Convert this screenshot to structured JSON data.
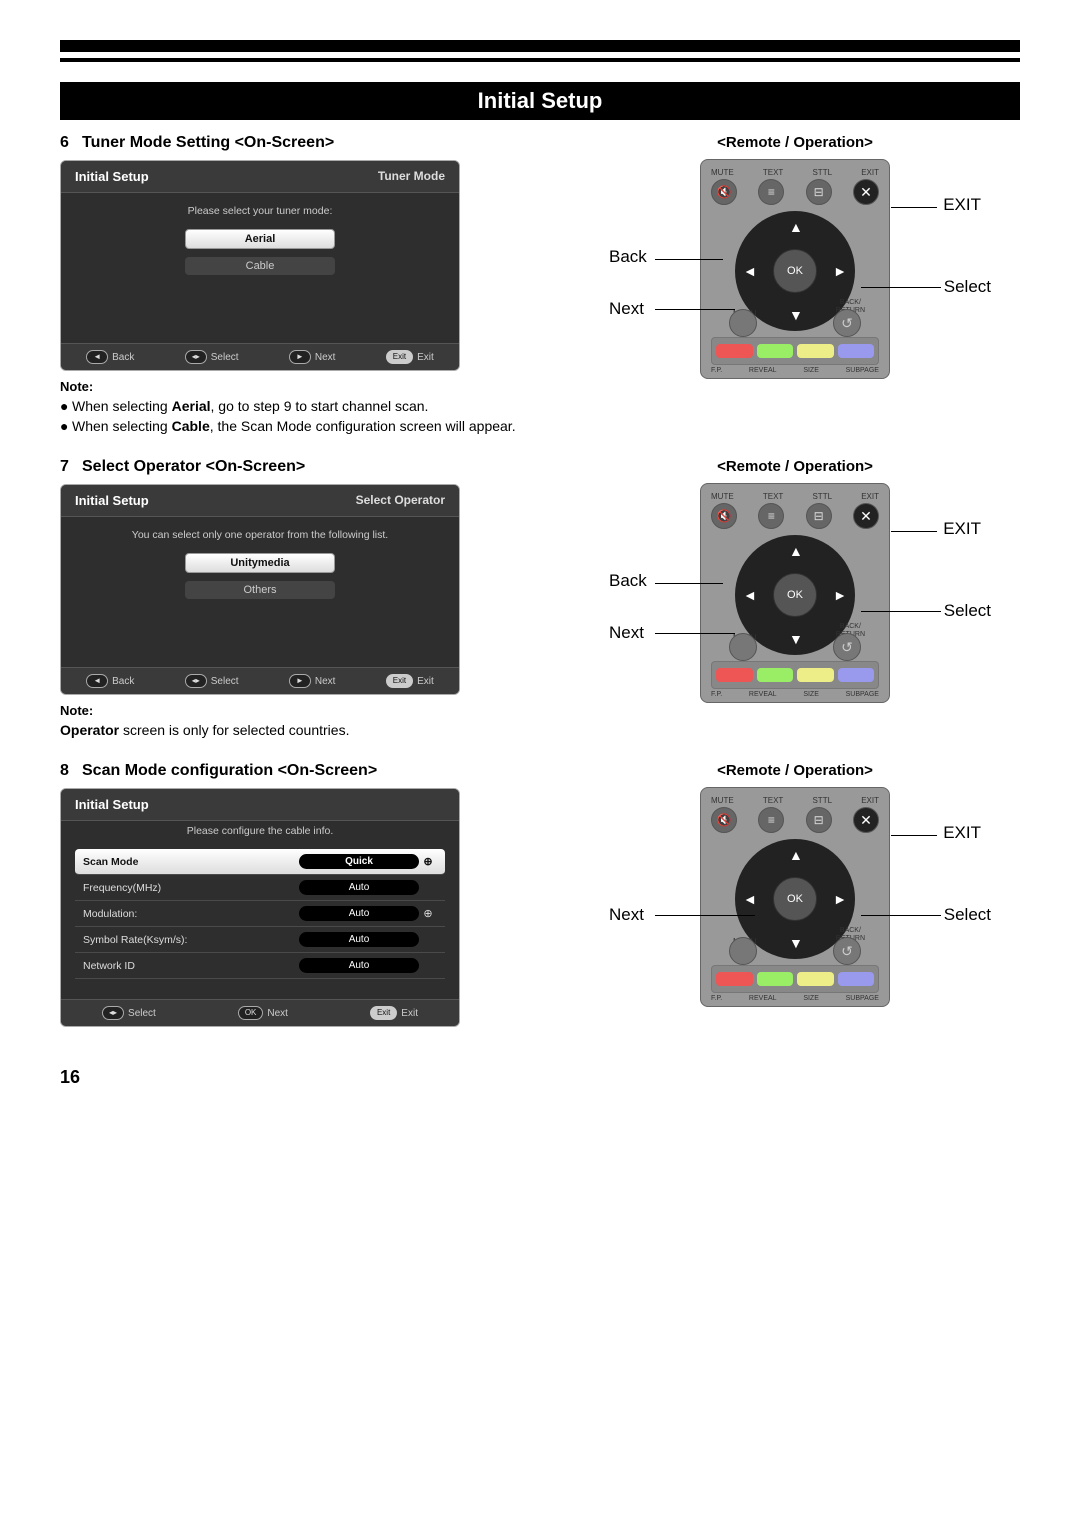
{
  "page_title": "Initial Setup",
  "page_number": "16",
  "step6": {
    "num": "6",
    "heading": "Tuner Mode Setting <On-Screen>",
    "remote_heading": "<Remote / Operation>",
    "osd_title": "Initial Setup",
    "osd_subtitle": "Tuner Mode",
    "osd_instruction": "Please select your tuner mode:",
    "opt_selected": "Aerial",
    "opt_other": "Cable",
    "footer": {
      "back": "Back",
      "select": "Select",
      "next": "Next",
      "exit": "Exit",
      "exit_icon": "Exit"
    },
    "note_head": "Note:",
    "note1_pre": "When selecting ",
    "note1_bold": "Aerial",
    "note1_post": ", go to step 9 to start channel scan.",
    "note2_pre": "When selecting ",
    "note2_bold": "Cable",
    "note2_post": ", the Scan Mode configuration screen will appear."
  },
  "step7": {
    "num": "7",
    "heading": "Select Operator <On-Screen>",
    "remote_heading": "<Remote / Operation>",
    "osd_title": "Initial Setup",
    "osd_subtitle": "Select Operator",
    "osd_instruction": "You can select only one operator from the following list.",
    "opt_selected": "Unitymedia",
    "opt_other": "Others",
    "footer": {
      "back": "Back",
      "select": "Select",
      "next": "Next",
      "exit": "Exit",
      "exit_icon": "Exit"
    },
    "note_head": "Note:",
    "note_bold": "Operator",
    "note_post": " screen is only for selected countries."
  },
  "step8": {
    "num": "8",
    "heading": "Scan Mode configuration <On-Screen>",
    "remote_heading": "<Remote / Operation>",
    "osd_title": "Initial Setup",
    "osd_instruction": "Please configure the cable info.",
    "rows": [
      {
        "label": "Scan Mode",
        "value": "Quick",
        "selected": true,
        "arrow": true
      },
      {
        "label": "Frequency(MHz)",
        "value": "Auto",
        "selected": false,
        "arrow": false
      },
      {
        "label": "Modulation:",
        "value": "Auto",
        "selected": false,
        "arrow": true
      },
      {
        "label": "Symbol Rate(Ksym/s):",
        "value": "Auto",
        "selected": false,
        "arrow": false
      },
      {
        "label": "Network ID",
        "value": "Auto",
        "selected": false,
        "arrow": false
      }
    ],
    "footer": {
      "select": "Select",
      "next": "Next",
      "ok": "OK",
      "exit": "Exit",
      "exit_icon": "Exit"
    }
  },
  "remote": {
    "top_labels": [
      "MUTE",
      "TEXT",
      "STTL",
      "EXIT"
    ],
    "ok": "OK",
    "menu": "MENU",
    "back_return": "BACK/\nRETURN",
    "bottom": [
      "F.P.",
      "REVEAL",
      "SIZE",
      "SUBPAGE"
    ],
    "callouts": {
      "exit": "EXIT",
      "select": "Select",
      "back": "Back",
      "next": "Next"
    }
  }
}
